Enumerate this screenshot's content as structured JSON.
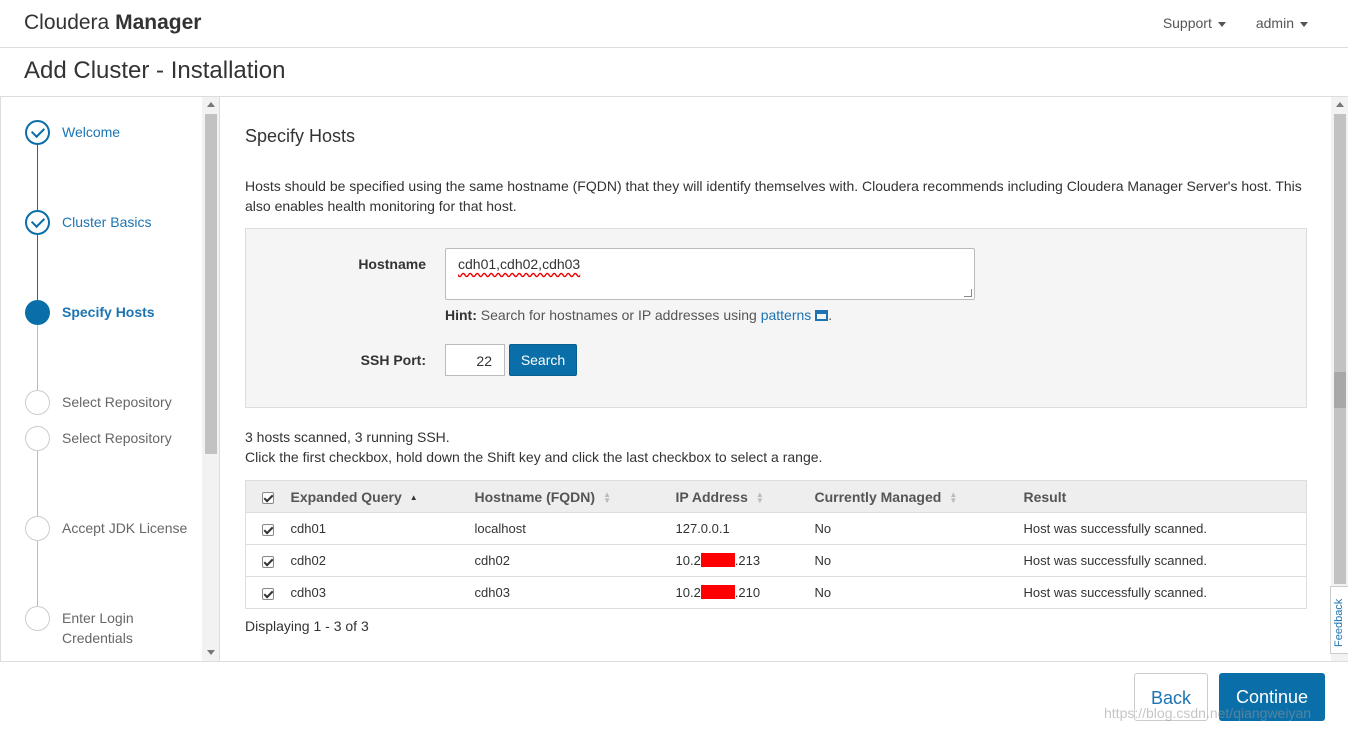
{
  "header": {
    "brand_light": "Cloudera",
    "brand_bold": "Manager",
    "nav": [
      {
        "label": "Support"
      },
      {
        "label": "admin"
      }
    ]
  },
  "page_title": "Add Cluster - Installation",
  "steps": [
    {
      "label": "Welcome",
      "state": "done"
    },
    {
      "label": "Cluster Basics",
      "state": "done"
    },
    {
      "label": "Specify Hosts",
      "state": "active"
    },
    {
      "label": "Select Repository",
      "state": "pending"
    },
    {
      "label": "Select Repository",
      "state": "pending"
    },
    {
      "label": "Accept JDK License",
      "state": "pending"
    },
    {
      "label": "Enter Login Credentials",
      "state": "pending"
    }
  ],
  "main": {
    "section_title": "Specify Hosts",
    "intro": "Hosts should be specified using the same hostname (FQDN) that they will identify themselves with. Cloudera recommends including Cloudera Manager Server's host. This also enables health monitoring for that host.",
    "hostname_label": "Hostname",
    "hostname_value": "cdh01,cdh02,cdh03",
    "hint_bold": "Hint:",
    "hint_text": "Search for hostnames or IP addresses using",
    "hint_link": "patterns",
    "ssh_label": "SSH Port:",
    "ssh_value": "22",
    "search_button": "Search",
    "scan_summary": "3 hosts scanned, 3 running SSH.",
    "scan_instruction": "Click the first checkbox, hold down the Shift key and click the last checkbox to select a range.",
    "table": {
      "columns": [
        "Expanded Query",
        "Hostname (FQDN)",
        "IP Address",
        "Currently Managed",
        "Result"
      ],
      "rows": [
        {
          "query": "cdh01",
          "fqdn": "localhost",
          "ip_prefix": "127.0.0.1",
          "ip_suffix": "",
          "redacted": false,
          "managed": "No",
          "result": "Host was successfully scanned."
        },
        {
          "query": "cdh02",
          "fqdn": "cdh02",
          "ip_prefix": "10.2",
          "ip_suffix": ".213",
          "redacted": true,
          "managed": "No",
          "result": "Host was successfully scanned."
        },
        {
          "query": "cdh03",
          "fqdn": "cdh03",
          "ip_prefix": "10.2",
          "ip_suffix": ".210",
          "redacted": true,
          "managed": "No",
          "result": "Host was successfully scanned."
        }
      ]
    },
    "displaying": "Displaying 1 - 3 of 3"
  },
  "feedback": "Feedback",
  "footer": {
    "back": "Back",
    "continue": "Continue",
    "watermark": "https://blog.csdn.net/qiangweiyan"
  },
  "colors": {
    "accent": "#0a6fa8",
    "link": "#1c74b3",
    "redaction": "#ff0000"
  }
}
